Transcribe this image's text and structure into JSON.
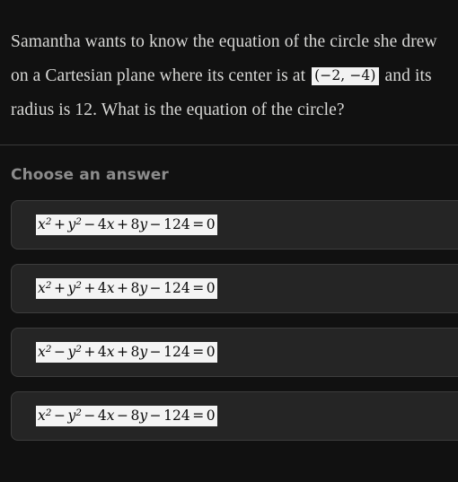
{
  "question": {
    "part1": "Samantha wants to know the equation of the circle she drew on a Cartesian plane where its center is at",
    "inline_math": "(−2, −4)",
    "part2": "and its radius is 12. What is the equation of the circle?"
  },
  "answers": {
    "heading": "Choose an answer",
    "options": [
      {
        "id": "option-1",
        "latex": "x^2 + y^2 - 4x + 8y - 124 = 0",
        "plain": "x² + y² − 4x + 8y − 124 = 0",
        "tokens": [
          {
            "t": "var",
            "v": "x"
          },
          {
            "t": "sup",
            "v": "2"
          },
          {
            "t": "op",
            "v": "+"
          },
          {
            "t": "var",
            "v": "y"
          },
          {
            "t": "sup",
            "v": "2"
          },
          {
            "t": "op",
            "v": "−"
          },
          {
            "t": "num",
            "v": "4"
          },
          {
            "t": "var",
            "v": "x"
          },
          {
            "t": "op",
            "v": "+"
          },
          {
            "t": "num",
            "v": "8"
          },
          {
            "t": "var",
            "v": "y"
          },
          {
            "t": "op",
            "v": "−"
          },
          {
            "t": "num",
            "v": "124"
          },
          {
            "t": "op",
            "v": "="
          },
          {
            "t": "num",
            "v": "0"
          }
        ]
      },
      {
        "id": "option-2",
        "latex": "x^2 + y^2 + 4x + 8y - 124 = 0",
        "plain": "x² + y² + 4x + 8y − 124 = 0",
        "tokens": [
          {
            "t": "var",
            "v": "x"
          },
          {
            "t": "sup",
            "v": "2"
          },
          {
            "t": "op",
            "v": "+"
          },
          {
            "t": "var",
            "v": "y"
          },
          {
            "t": "sup",
            "v": "2"
          },
          {
            "t": "op",
            "v": "+"
          },
          {
            "t": "num",
            "v": "4"
          },
          {
            "t": "var",
            "v": "x"
          },
          {
            "t": "op",
            "v": "+"
          },
          {
            "t": "num",
            "v": "8"
          },
          {
            "t": "var",
            "v": "y"
          },
          {
            "t": "op",
            "v": "−"
          },
          {
            "t": "num",
            "v": "124"
          },
          {
            "t": "op",
            "v": "="
          },
          {
            "t": "num",
            "v": "0"
          }
        ]
      },
      {
        "id": "option-3",
        "latex": "x^2 - y^2 + 4x + 8y - 124 = 0",
        "plain": "x² − y² + 4x + 8y − 124 = 0",
        "tokens": [
          {
            "t": "var",
            "v": "x"
          },
          {
            "t": "sup",
            "v": "2"
          },
          {
            "t": "op",
            "v": "−"
          },
          {
            "t": "var",
            "v": "y"
          },
          {
            "t": "sup",
            "v": "2"
          },
          {
            "t": "op",
            "v": "+"
          },
          {
            "t": "num",
            "v": "4"
          },
          {
            "t": "var",
            "v": "x"
          },
          {
            "t": "op",
            "v": "+"
          },
          {
            "t": "num",
            "v": "8"
          },
          {
            "t": "var",
            "v": "y"
          },
          {
            "t": "op",
            "v": "−"
          },
          {
            "t": "num",
            "v": "124"
          },
          {
            "t": "op",
            "v": "="
          },
          {
            "t": "num",
            "v": "0"
          }
        ]
      },
      {
        "id": "option-4",
        "latex": "x^2 - y^2 - 4x - 8y - 124 = 0",
        "plain": "x² − y² − 4x − 8y − 124 = 0",
        "tokens": [
          {
            "t": "var",
            "v": "x"
          },
          {
            "t": "sup",
            "v": "2"
          },
          {
            "t": "op",
            "v": "−"
          },
          {
            "t": "var",
            "v": "y"
          },
          {
            "t": "sup",
            "v": "2"
          },
          {
            "t": "op",
            "v": "−"
          },
          {
            "t": "num",
            "v": "4"
          },
          {
            "t": "var",
            "v": "x"
          },
          {
            "t": "op",
            "v": "−"
          },
          {
            "t": "num",
            "v": "8"
          },
          {
            "t": "var",
            "v": "y"
          },
          {
            "t": "op",
            "v": "−"
          },
          {
            "t": "num",
            "v": "124"
          },
          {
            "t": "op",
            "v": "="
          },
          {
            "t": "num",
            "v": "0"
          }
        ]
      }
    ]
  },
  "colors": {
    "page_background": "#111111",
    "body_text": "#d8d8d6",
    "heading_text": "#8c8c8c",
    "card_background": "#252525",
    "card_border": "#3d3d3d",
    "math_highlight_background": "#f2f2f2",
    "math_text": "#0a0a0a",
    "divider": "#3a3a3a"
  }
}
